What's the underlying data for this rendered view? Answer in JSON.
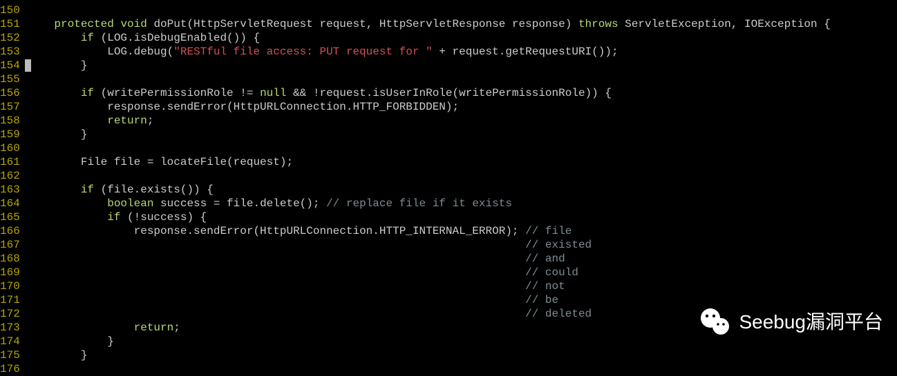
{
  "gutter": {
    "start": 150,
    "end": 176
  },
  "cursorLine": 153,
  "code": {
    "lines": [
      {
        "n": 150,
        "tokens": [
          {
            "t": "    ",
            "c": "plain"
          }
        ]
      },
      {
        "n": 151,
        "tokens": [
          {
            "t": "    ",
            "c": "plain"
          },
          {
            "t": "protected",
            "c": "kw"
          },
          {
            "t": " ",
            "c": "plain"
          },
          {
            "t": "void",
            "c": "kw"
          },
          {
            "t": " doPut(HttpServletRequest request, HttpServletResponse response) ",
            "c": "plain"
          },
          {
            "t": "throws",
            "c": "kw"
          },
          {
            "t": " ServletException, IOException {",
            "c": "plain"
          }
        ]
      },
      {
        "n": 152,
        "tokens": [
          {
            "t": "        ",
            "c": "plain"
          },
          {
            "t": "if",
            "c": "kw"
          },
          {
            "t": " (LOG.isDebugEnabled()) {",
            "c": "plain"
          }
        ]
      },
      {
        "n": 153,
        "tokens": [
          {
            "t": "            LOG.debug(",
            "c": "plain"
          },
          {
            "t": "\"RESTful file access: PUT request for \"",
            "c": "str"
          },
          {
            "t": " + request.getRequestURI());",
            "c": "plain"
          }
        ]
      },
      {
        "n": 154,
        "tokens": [
          {
            "t": "        }",
            "c": "plain"
          }
        ]
      },
      {
        "n": 155,
        "tokens": [
          {
            "t": "",
            "c": "plain"
          }
        ]
      },
      {
        "n": 156,
        "tokens": [
          {
            "t": "        ",
            "c": "plain"
          },
          {
            "t": "if",
            "c": "kw"
          },
          {
            "t": " (writePermissionRole != ",
            "c": "plain"
          },
          {
            "t": "null",
            "c": "kw"
          },
          {
            "t": " && !request.isUserInRole(writePermissionRole)) {",
            "c": "plain"
          }
        ]
      },
      {
        "n": 157,
        "tokens": [
          {
            "t": "            response.sendError(HttpURLConnection.HTTP_FORBIDDEN);",
            "c": "plain"
          }
        ]
      },
      {
        "n": 158,
        "tokens": [
          {
            "t": "            ",
            "c": "plain"
          },
          {
            "t": "return",
            "c": "kw"
          },
          {
            "t": ";",
            "c": "plain"
          }
        ]
      },
      {
        "n": 159,
        "tokens": [
          {
            "t": "        }",
            "c": "plain"
          }
        ]
      },
      {
        "n": 160,
        "tokens": [
          {
            "t": "",
            "c": "plain"
          }
        ]
      },
      {
        "n": 161,
        "tokens": [
          {
            "t": "        File file = locateFile(request);",
            "c": "plain"
          }
        ]
      },
      {
        "n": 162,
        "tokens": [
          {
            "t": "",
            "c": "plain"
          }
        ]
      },
      {
        "n": 163,
        "tokens": [
          {
            "t": "        ",
            "c": "plain"
          },
          {
            "t": "if",
            "c": "kw"
          },
          {
            "t": " (file.exists()) {",
            "c": "plain"
          }
        ]
      },
      {
        "n": 164,
        "tokens": [
          {
            "t": "            ",
            "c": "plain"
          },
          {
            "t": "boolean",
            "c": "kw"
          },
          {
            "t": " success = file.delete(); ",
            "c": "plain"
          },
          {
            "t": "// replace file if it exists",
            "c": "cm"
          }
        ]
      },
      {
        "n": 165,
        "tokens": [
          {
            "t": "            ",
            "c": "plain"
          },
          {
            "t": "if",
            "c": "kw"
          },
          {
            "t": " (!success) {",
            "c": "plain"
          }
        ]
      },
      {
        "n": 166,
        "tokens": [
          {
            "t": "                response.sendError(HttpURLConnection.HTTP_INTERNAL_ERROR); ",
            "c": "plain"
          },
          {
            "t": "// file",
            "c": "cm"
          }
        ]
      },
      {
        "n": 167,
        "tokens": [
          {
            "t": "                                                                           ",
            "c": "plain"
          },
          {
            "t": "// existed",
            "c": "cm"
          }
        ]
      },
      {
        "n": 168,
        "tokens": [
          {
            "t": "                                                                           ",
            "c": "plain"
          },
          {
            "t": "// and",
            "c": "cm"
          }
        ]
      },
      {
        "n": 169,
        "tokens": [
          {
            "t": "                                                                           ",
            "c": "plain"
          },
          {
            "t": "// could",
            "c": "cm"
          }
        ]
      },
      {
        "n": 170,
        "tokens": [
          {
            "t": "                                                                           ",
            "c": "plain"
          },
          {
            "t": "// not",
            "c": "cm"
          }
        ]
      },
      {
        "n": 171,
        "tokens": [
          {
            "t": "                                                                           ",
            "c": "plain"
          },
          {
            "t": "// be",
            "c": "cm"
          }
        ]
      },
      {
        "n": 172,
        "tokens": [
          {
            "t": "                                                                           ",
            "c": "plain"
          },
          {
            "t": "// deleted",
            "c": "cm"
          }
        ]
      },
      {
        "n": 173,
        "tokens": [
          {
            "t": "                ",
            "c": "plain"
          },
          {
            "t": "return",
            "c": "kw"
          },
          {
            "t": ";",
            "c": "plain"
          }
        ]
      },
      {
        "n": 174,
        "tokens": [
          {
            "t": "            }",
            "c": "plain"
          }
        ]
      },
      {
        "n": 175,
        "tokens": [
          {
            "t": "        }",
            "c": "plain"
          }
        ]
      },
      {
        "n": 176,
        "tokens": [
          {
            "t": "",
            "c": "plain"
          }
        ]
      }
    ]
  },
  "watermark": {
    "text": "Seebug漏洞平台"
  }
}
